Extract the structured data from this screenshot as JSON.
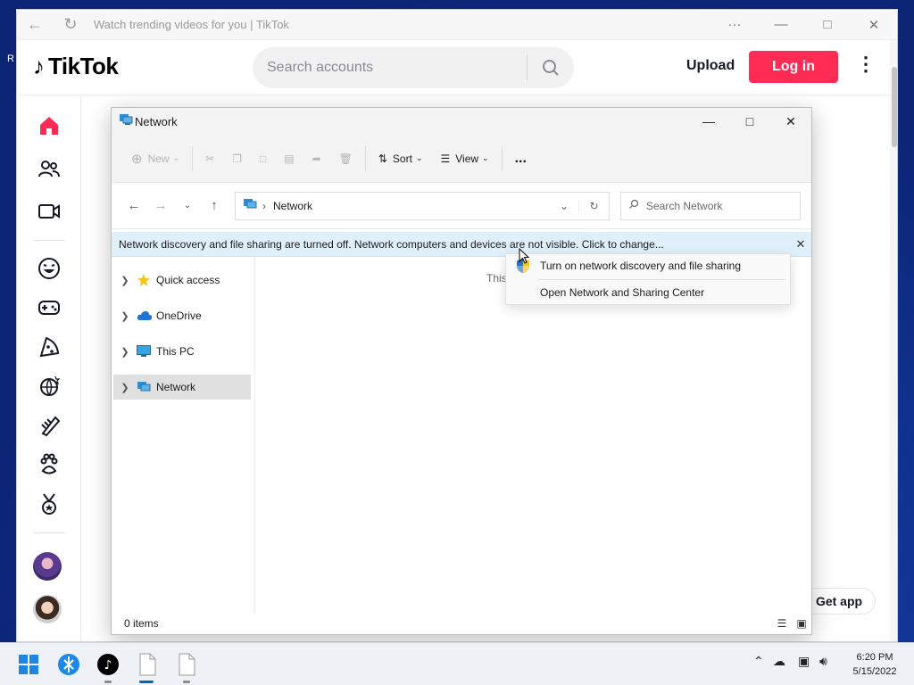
{
  "desktop": {
    "partial_label": "R"
  },
  "browser": {
    "title": "Watch trending videos for you | TikTok",
    "tiktok": {
      "logo_text": "TikTok",
      "search_placeholder": "Search accounts",
      "upload_label": "Upload",
      "login_label": "Log in",
      "get_app_label": "Get app"
    }
  },
  "explorer": {
    "title": "Network",
    "toolbar": {
      "new_label": "New",
      "sort_label": "Sort",
      "view_label": "View",
      "more_label": "..."
    },
    "address": {
      "crumb": "Network",
      "search_placeholder": "Search Network"
    },
    "infobar": {
      "message": "Network discovery and file sharing are turned off. Network computers and devices are not visible. Click to change..."
    },
    "nav_items": [
      {
        "label": "Quick access",
        "icon": "star-icon"
      },
      {
        "label": "OneDrive",
        "icon": "cloud-icon"
      },
      {
        "label": "This PC",
        "icon": "monitor-icon"
      },
      {
        "label": "Network",
        "icon": "network-icon",
        "selected": true
      }
    ],
    "content_partial": "This",
    "status": {
      "items": "0 items"
    }
  },
  "context_menu": {
    "items": [
      {
        "label": "Turn on network discovery and file sharing",
        "icon": "shield-icon"
      },
      {
        "label": "Open Network and Sharing Center"
      }
    ]
  },
  "taskbar": {
    "time": "6:20 PM",
    "date": "5/15/2022"
  },
  "colors": {
    "tiktok_red": "#fe2c55",
    "infobar_bg": "#dff0fb",
    "accent_blue": "#0067c0"
  }
}
